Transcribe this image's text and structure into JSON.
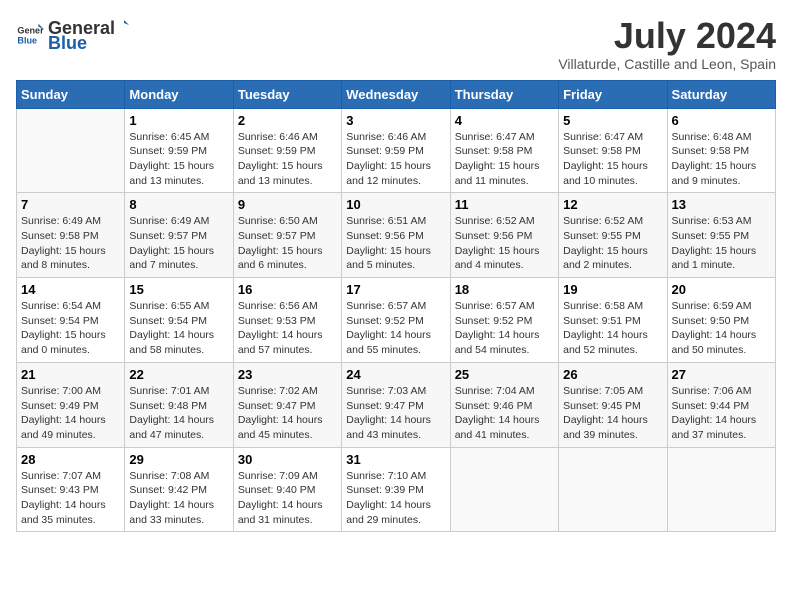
{
  "header": {
    "logo": {
      "general": "General",
      "blue": "Blue"
    },
    "month": "July 2024",
    "location": "Villaturde, Castille and Leon, Spain"
  },
  "weekdays": [
    "Sunday",
    "Monday",
    "Tuesday",
    "Wednesday",
    "Thursday",
    "Friday",
    "Saturday"
  ],
  "weeks": [
    [
      {
        "day": "",
        "info": ""
      },
      {
        "day": "1",
        "info": "Sunrise: 6:45 AM\nSunset: 9:59 PM\nDaylight: 15 hours\nand 13 minutes."
      },
      {
        "day": "2",
        "info": "Sunrise: 6:46 AM\nSunset: 9:59 PM\nDaylight: 15 hours\nand 13 minutes."
      },
      {
        "day": "3",
        "info": "Sunrise: 6:46 AM\nSunset: 9:59 PM\nDaylight: 15 hours\nand 12 minutes."
      },
      {
        "day": "4",
        "info": "Sunrise: 6:47 AM\nSunset: 9:58 PM\nDaylight: 15 hours\nand 11 minutes."
      },
      {
        "day": "5",
        "info": "Sunrise: 6:47 AM\nSunset: 9:58 PM\nDaylight: 15 hours\nand 10 minutes."
      },
      {
        "day": "6",
        "info": "Sunrise: 6:48 AM\nSunset: 9:58 PM\nDaylight: 15 hours\nand 9 minutes."
      }
    ],
    [
      {
        "day": "7",
        "info": "Sunrise: 6:49 AM\nSunset: 9:58 PM\nDaylight: 15 hours\nand 8 minutes."
      },
      {
        "day": "8",
        "info": "Sunrise: 6:49 AM\nSunset: 9:57 PM\nDaylight: 15 hours\nand 7 minutes."
      },
      {
        "day": "9",
        "info": "Sunrise: 6:50 AM\nSunset: 9:57 PM\nDaylight: 15 hours\nand 6 minutes."
      },
      {
        "day": "10",
        "info": "Sunrise: 6:51 AM\nSunset: 9:56 PM\nDaylight: 15 hours\nand 5 minutes."
      },
      {
        "day": "11",
        "info": "Sunrise: 6:52 AM\nSunset: 9:56 PM\nDaylight: 15 hours\nand 4 minutes."
      },
      {
        "day": "12",
        "info": "Sunrise: 6:52 AM\nSunset: 9:55 PM\nDaylight: 15 hours\nand 2 minutes."
      },
      {
        "day": "13",
        "info": "Sunrise: 6:53 AM\nSunset: 9:55 PM\nDaylight: 15 hours\nand 1 minute."
      }
    ],
    [
      {
        "day": "14",
        "info": "Sunrise: 6:54 AM\nSunset: 9:54 PM\nDaylight: 15 hours\nand 0 minutes."
      },
      {
        "day": "15",
        "info": "Sunrise: 6:55 AM\nSunset: 9:54 PM\nDaylight: 14 hours\nand 58 minutes."
      },
      {
        "day": "16",
        "info": "Sunrise: 6:56 AM\nSunset: 9:53 PM\nDaylight: 14 hours\nand 57 minutes."
      },
      {
        "day": "17",
        "info": "Sunrise: 6:57 AM\nSunset: 9:52 PM\nDaylight: 14 hours\nand 55 minutes."
      },
      {
        "day": "18",
        "info": "Sunrise: 6:57 AM\nSunset: 9:52 PM\nDaylight: 14 hours\nand 54 minutes."
      },
      {
        "day": "19",
        "info": "Sunrise: 6:58 AM\nSunset: 9:51 PM\nDaylight: 14 hours\nand 52 minutes."
      },
      {
        "day": "20",
        "info": "Sunrise: 6:59 AM\nSunset: 9:50 PM\nDaylight: 14 hours\nand 50 minutes."
      }
    ],
    [
      {
        "day": "21",
        "info": "Sunrise: 7:00 AM\nSunset: 9:49 PM\nDaylight: 14 hours\nand 49 minutes."
      },
      {
        "day": "22",
        "info": "Sunrise: 7:01 AM\nSunset: 9:48 PM\nDaylight: 14 hours\nand 47 minutes."
      },
      {
        "day": "23",
        "info": "Sunrise: 7:02 AM\nSunset: 9:47 PM\nDaylight: 14 hours\nand 45 minutes."
      },
      {
        "day": "24",
        "info": "Sunrise: 7:03 AM\nSunset: 9:47 PM\nDaylight: 14 hours\nand 43 minutes."
      },
      {
        "day": "25",
        "info": "Sunrise: 7:04 AM\nSunset: 9:46 PM\nDaylight: 14 hours\nand 41 minutes."
      },
      {
        "day": "26",
        "info": "Sunrise: 7:05 AM\nSunset: 9:45 PM\nDaylight: 14 hours\nand 39 minutes."
      },
      {
        "day": "27",
        "info": "Sunrise: 7:06 AM\nSunset: 9:44 PM\nDaylight: 14 hours\nand 37 minutes."
      }
    ],
    [
      {
        "day": "28",
        "info": "Sunrise: 7:07 AM\nSunset: 9:43 PM\nDaylight: 14 hours\nand 35 minutes."
      },
      {
        "day": "29",
        "info": "Sunrise: 7:08 AM\nSunset: 9:42 PM\nDaylight: 14 hours\nand 33 minutes."
      },
      {
        "day": "30",
        "info": "Sunrise: 7:09 AM\nSunset: 9:40 PM\nDaylight: 14 hours\nand 31 minutes."
      },
      {
        "day": "31",
        "info": "Sunrise: 7:10 AM\nSunset: 9:39 PM\nDaylight: 14 hours\nand 29 minutes."
      },
      {
        "day": "",
        "info": ""
      },
      {
        "day": "",
        "info": ""
      },
      {
        "day": "",
        "info": ""
      }
    ]
  ]
}
